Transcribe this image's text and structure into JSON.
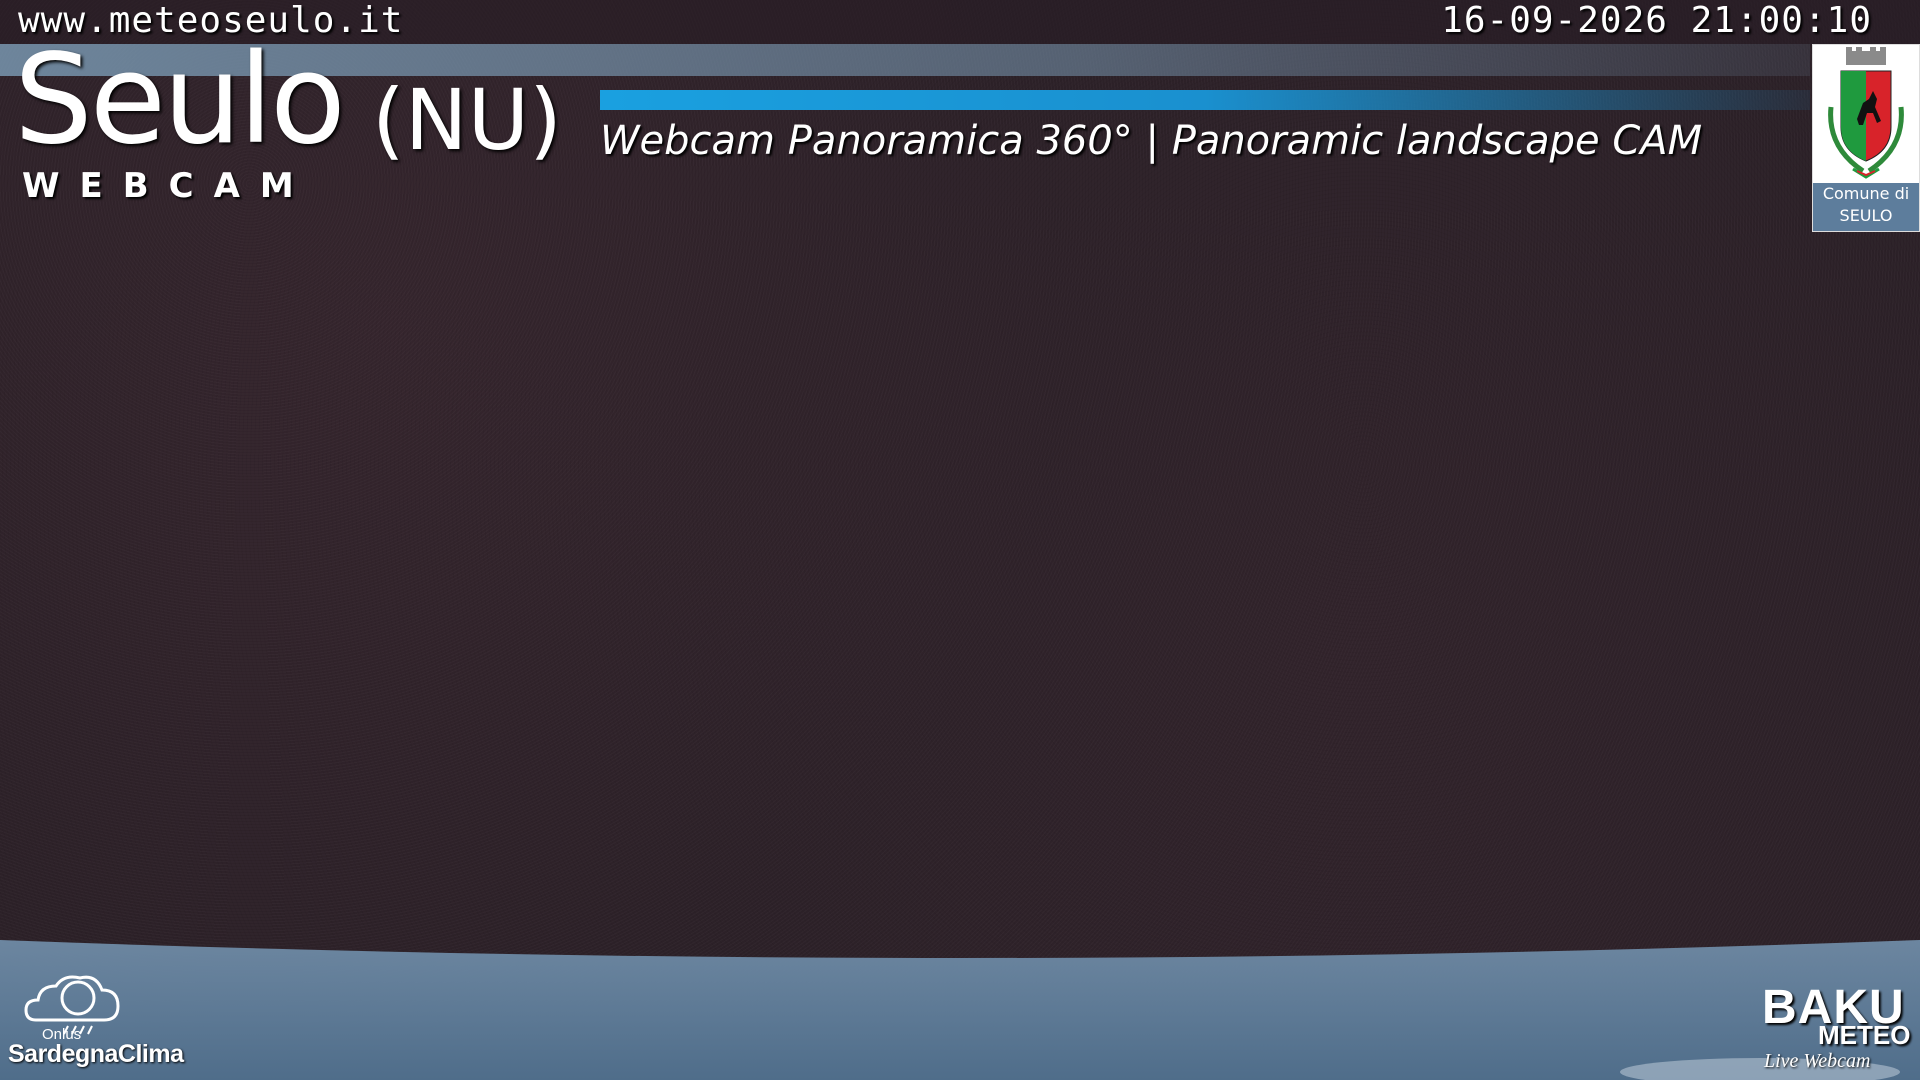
{
  "overlay": {
    "url": "www.meteoseulo.it",
    "datetime": "16-09-2026 21:00:10",
    "town": "Seulo",
    "province": "(NU)",
    "webcam_word": "WEBCAM",
    "subtitle": "Webcam Panoramica 360°  | Panoramic landscape CAM"
  },
  "crest": {
    "caption_line1": "Comune di",
    "caption_line2": "SEULO",
    "icon": "coat-of-arms-icon"
  },
  "sponsors": {
    "left_onlus": "Onlus",
    "left_name": "SardegnaClima",
    "right_name_top": "BAKU",
    "right_name_bottom": "METEO",
    "right_tagline": "Live Webcam"
  },
  "colors": {
    "sky": "#2c2128",
    "accent_blue": "#1aa0e0",
    "band": "#7896af",
    "caption_bg": "#5d7d9c"
  }
}
